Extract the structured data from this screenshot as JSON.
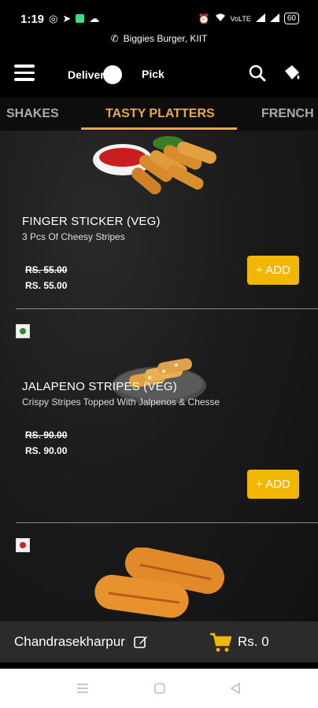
{
  "status_bar": {
    "time": "1:19",
    "left_icons": [
      "whatsapp-icon",
      "telegram-icon",
      "app-icon",
      "cloud-icon"
    ],
    "right_icons": [
      "alarm-icon",
      "wifi-icon",
      "volte-icon",
      "signal-icon",
      "signal-icon"
    ],
    "battery": "60"
  },
  "location": {
    "label": "Biggies Burger, KIIT",
    "icon": "phone-icon"
  },
  "header": {
    "deliver_label": "Deliver",
    "pick_label": "Pick",
    "icons": [
      "menu-icon",
      "search-icon",
      "bucket-icon"
    ]
  },
  "tabs": [
    {
      "label": "SHAKES"
    },
    {
      "label": "TASTY PLATTERS"
    },
    {
      "label": "FRENCH F"
    }
  ],
  "active_tab": "TASTY PLATTERS",
  "items": [
    {
      "name": "FINGER STICKER (VEG)",
      "description": "3 Pcs Of Cheesy Stripes",
      "old_price": "RS. 55.00",
      "price": "RS. 55.00",
      "add_label": "+ ADD",
      "type": "veg"
    },
    {
      "name": "JALAPENO STRIPES (VEG)",
      "description": "Crispy Stripes Topped With Jalpenos & Chesse",
      "old_price": "RS. 90.00",
      "price": "RS. 90.00",
      "add_label": "+ ADD",
      "type": "veg"
    },
    {
      "type": "nonveg"
    }
  ],
  "bottom_bar": {
    "area": "Chandrasekharpur",
    "cart_total": "Rs. 0"
  },
  "colors": {
    "accent": "#e8a84c",
    "add_button": "#f2b705",
    "veg": "#2e8b2e",
    "nonveg": "#c62828"
  }
}
